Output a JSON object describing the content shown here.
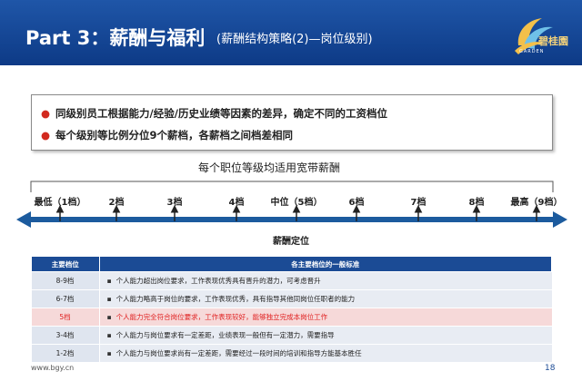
{
  "header": {
    "title": "Part 3：薪酬与福利",
    "subtitle": "(薪酬结构策略(2)—岗位级别)",
    "logo_text": "碧桂園",
    "logo_sub": "GARDEN"
  },
  "bullets": [
    "同级别员工根据能力/经验/历史业绩等因素的差异，确定不同的工资档位",
    "每个级别等比例分位9个薪档，各薪档之间档差相同"
  ],
  "brace_label": "每个职位等级均适用宽带薪酬",
  "scale": {
    "ticks": [
      "最低（1档）",
      "2档",
      "3档",
      "4档",
      "中位（5档）",
      "6档",
      "7档",
      "8档",
      "最高（9档）"
    ],
    "caption": "薪酬定位"
  },
  "table": {
    "headers": [
      "主要档位",
      "各主要档位的一般标准"
    ],
    "rows": [
      {
        "grade": "8-9档",
        "desc": "个人能力超出岗位要求，工作表现优秀具有晋升的潜力，可考虑晋升",
        "highlight": false
      },
      {
        "grade": "6-7档",
        "desc": "个人能力略高于岗位的要求，工作表现优秀，具有指导其他同岗位任职者的能力",
        "highlight": false
      },
      {
        "grade": "5档",
        "desc": "个人能力完全符合岗位要求，工作表现较好，能够独立完成本岗位工作",
        "highlight": true
      },
      {
        "grade": "3-4档",
        "desc": "个人能力与岗位要求有一定差距，业绩表现一般但有一定潜力，需要指导",
        "highlight": false
      },
      {
        "grade": "1-2档",
        "desc": "个人能力与岗位要求尚有一定差距，需要经过一段时间的培训和指导方能基本胜任",
        "highlight": false
      }
    ]
  },
  "footer": {
    "url": "www.bgy.cn",
    "page": "18"
  },
  "colors": {
    "header_blue": "#1a4f9f",
    "table_header": "#1b4b95",
    "bullet_red": "#d22a1f",
    "highlight_red": "#e02020",
    "arrow_blue": "#1c5b9e"
  }
}
